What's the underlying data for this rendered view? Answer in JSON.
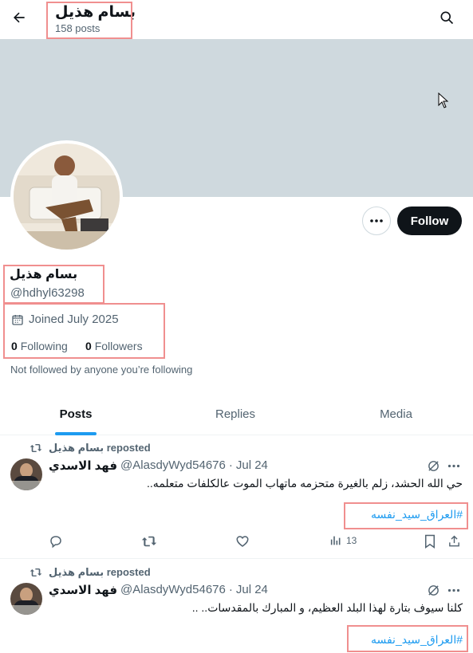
{
  "header": {
    "title": "بسام هذيل",
    "post_count": "158 posts"
  },
  "profile": {
    "display_name": "بسام هذيل",
    "handle": "@hdhyl63298",
    "joined": "Joined July 2025",
    "following_count": "0",
    "following_label": "Following",
    "followers_count": "0",
    "followers_label": "Followers",
    "mutuals_note": "Not followed by anyone you’re following",
    "follow_label": "Follow"
  },
  "tabs": [
    {
      "label": "Posts",
      "active": true
    },
    {
      "label": "Replies",
      "active": false
    },
    {
      "label": "Media",
      "active": false
    }
  ],
  "posts": [
    {
      "repost_label": "بسام هذيل reposted",
      "author_name": "فهد الاسدي",
      "author_handle": "@AlasdyWyd54676",
      "separator": "·",
      "date": "Jul 24",
      "text": "حي الله الحشد، زلم بالغيرة متحزمه ماتهاب الموت عالكلفات متعلمه..",
      "hashtag": "#العراق_سيد_نفسه",
      "views": "13"
    },
    {
      "repost_label": "بسام هذيل reposted",
      "author_name": "فهد الاسدي",
      "author_handle": "@AlasdyWyd54676",
      "separator": "·",
      "date": "Jul 24",
      "text": "كلنا سيوف بتارة لهذا البلد العظيم، و المبارك بالمقدسات.. ..",
      "hashtag": "#العراق_سيد_نفسه"
    }
  ],
  "colors": {
    "accent": "#1d9bf0",
    "banner": "#cfd9de",
    "follow_bg": "#0f1419",
    "annotation": "#f08f8f"
  }
}
